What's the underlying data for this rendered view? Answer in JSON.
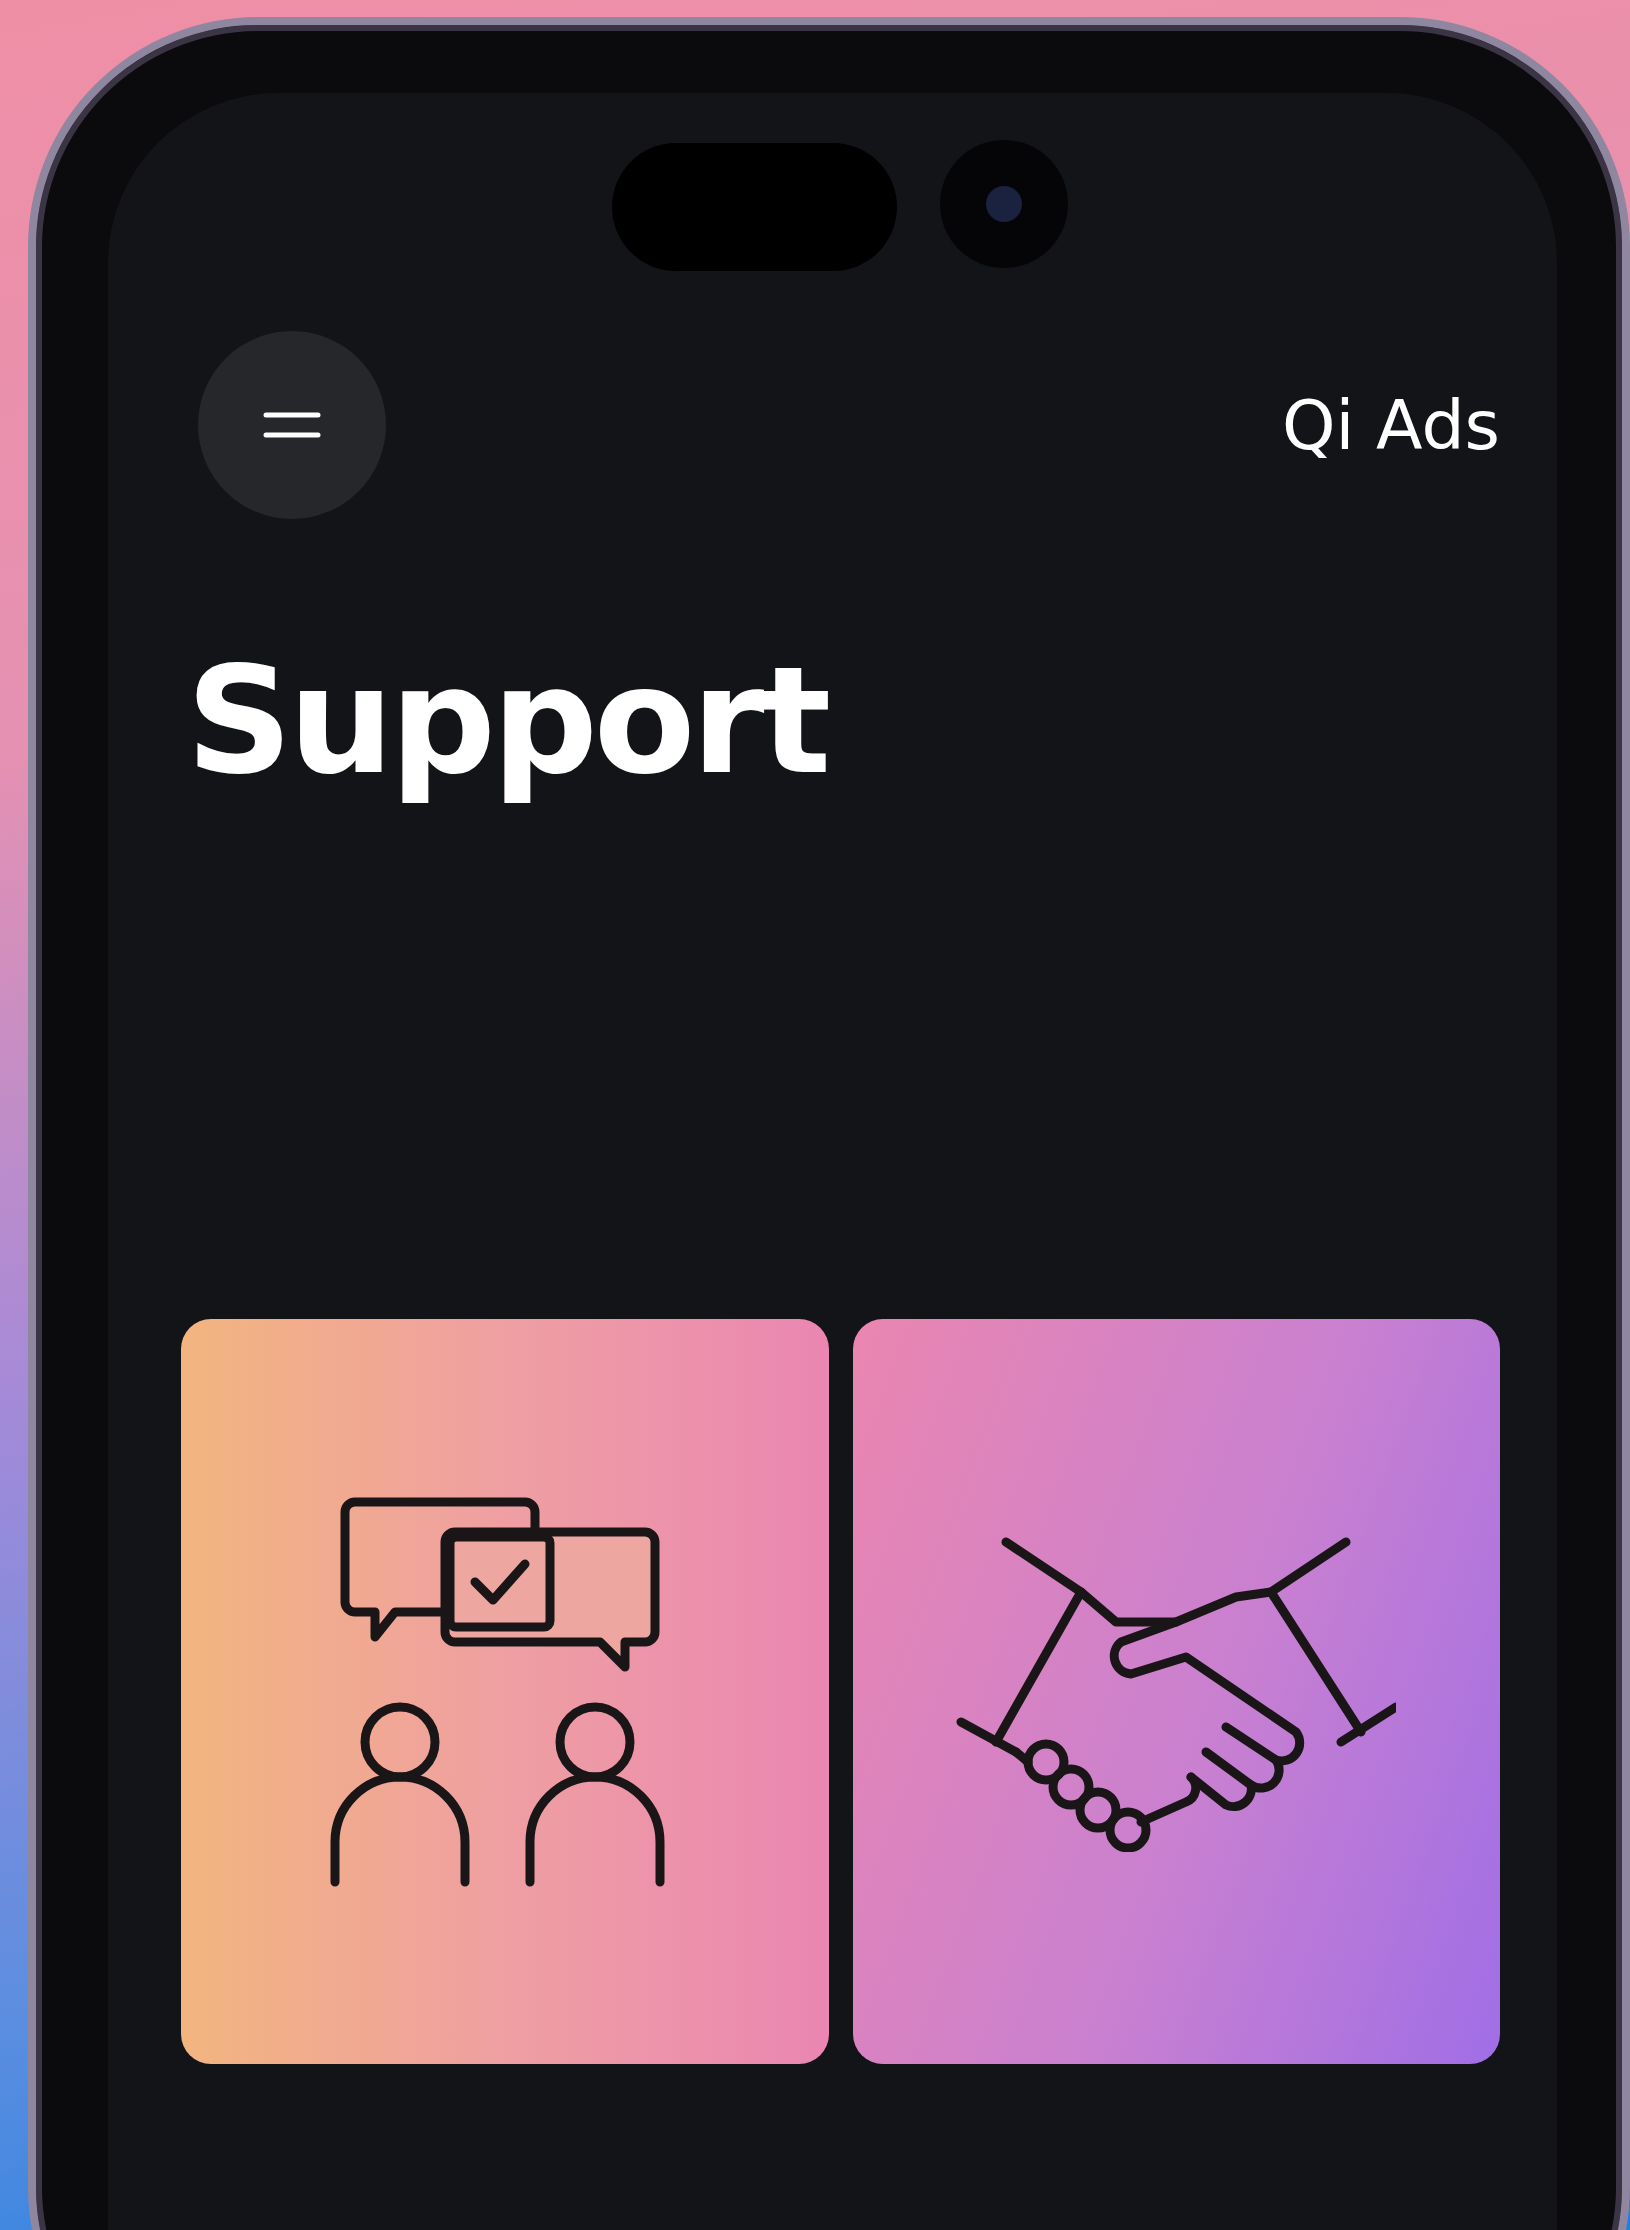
{
  "header": {
    "app_title": "Qi Ads"
  },
  "page_title": "Support",
  "cards": [
    {
      "kind": "chat"
    },
    {
      "kind": "handshake"
    }
  ]
}
